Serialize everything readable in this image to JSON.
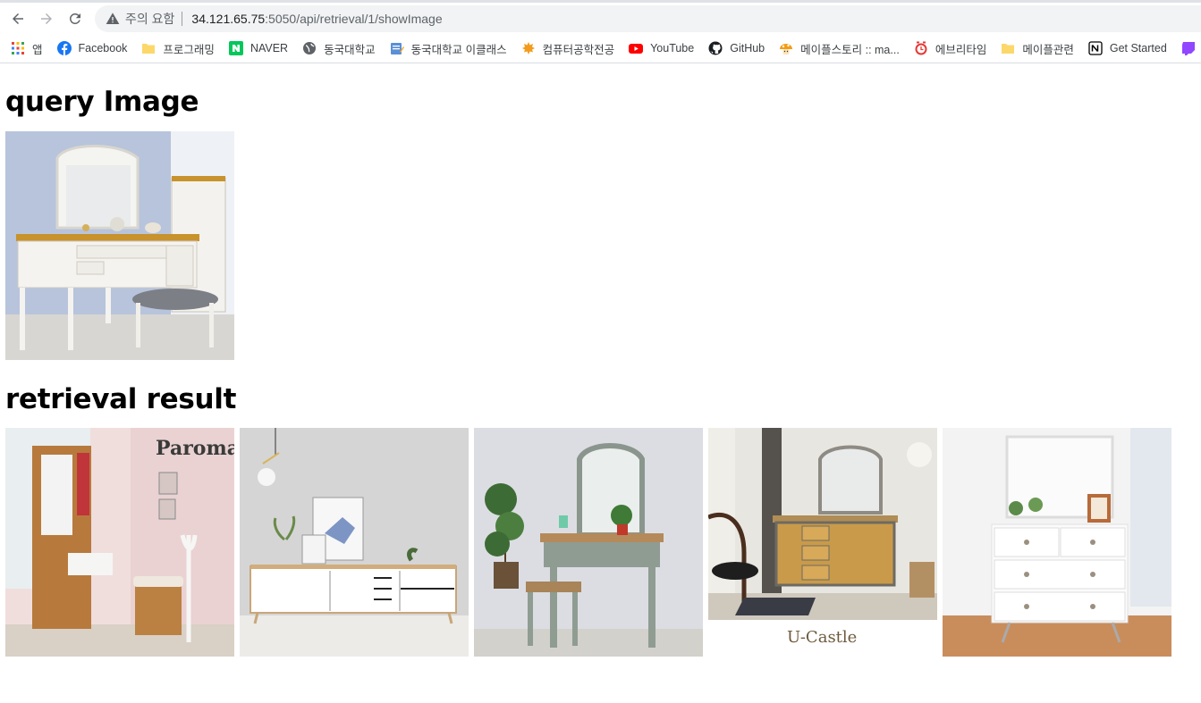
{
  "browser": {
    "security_warning": "주의 요함",
    "url_host": "34.121.65.75",
    "url_rest": ":5050/api/retrieval/1/showImage"
  },
  "bookmarks": [
    {
      "label": "앱",
      "icon": "apps-grid-icon"
    },
    {
      "label": "Facebook",
      "icon": "facebook-icon"
    },
    {
      "label": "프로그래밍",
      "icon": "folder-icon"
    },
    {
      "label": "NAVER",
      "icon": "naver-icon"
    },
    {
      "label": "동국대학교",
      "icon": "globe-icon"
    },
    {
      "label": "동국대학교 이클래스",
      "icon": "notepad-icon"
    },
    {
      "label": "컴퓨터공학전공",
      "icon": "maple-leaf-icon"
    },
    {
      "label": "YouTube",
      "icon": "youtube-icon"
    },
    {
      "label": "GitHub",
      "icon": "github-icon"
    },
    {
      "label": "메이플스토리 :: ma...",
      "icon": "mushroom-icon"
    },
    {
      "label": "에브리타임",
      "icon": "clock-icon"
    },
    {
      "label": "메이플관련",
      "icon": "folder-icon"
    },
    {
      "label": "Get Started",
      "icon": "notion-icon"
    }
  ],
  "page": {
    "query_heading": "query Image",
    "result_heading": "retrieval result",
    "query_image": {
      "description": "white vanity dresser with mirror and stool",
      "icon": "query-image"
    },
    "results": [
      {
        "logo_text": "Paroma"
      },
      {
        "logo_text": ""
      },
      {
        "logo_text": ""
      },
      {
        "logo_text": "U-Castle"
      },
      {
        "logo_text": ""
      }
    ]
  },
  "colors": {
    "omnibox_bg": "#f1f3f4",
    "youtube_red": "#ff0000",
    "naver_green": "#03c75a",
    "facebook_blue": "#1877f2"
  }
}
